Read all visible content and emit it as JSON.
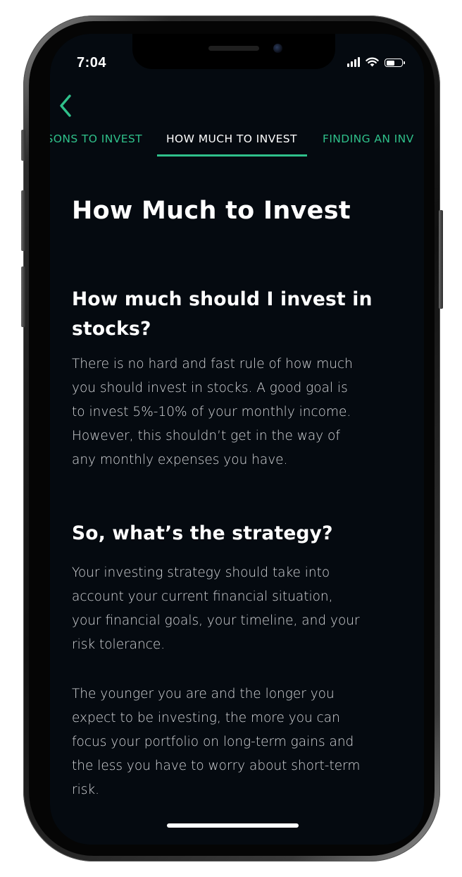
{
  "status_bar": {
    "time": "7:04",
    "battery_level": 0.55
  },
  "nav": {
    "back_icon": "chevron-left-icon",
    "accent_color": "#2fc08a"
  },
  "tabs": [
    {
      "label": "SONS TO INVEST",
      "active": false
    },
    {
      "label": "HOW MUCH TO INVEST",
      "active": true
    },
    {
      "label": "FINDING AN INV",
      "active": false
    }
  ],
  "article": {
    "title": "How Much to Invest",
    "sections": [
      {
        "heading_line1": "How much should I invest in",
        "heading_line2": "stocks?",
        "paragraphs": [
          {
            "lines": [
              "There is no hard and fast rule of how much",
              "you should invest in stocks. A good goal is",
              "to invest 5%-10% of your monthly income.",
              "However, this shouldn’t get in the way of",
              "any monthly expenses you have."
            ]
          }
        ]
      },
      {
        "heading_line1": "So, what’s the strategy?",
        "paragraphs": [
          {
            "lines": [
              "Your investing strategy should take into",
              "account your current financial situation,",
              "your financial goals, your timeline, and your",
              "risk tolerance."
            ]
          },
          {
            "lines": [
              "The younger you are and the longer you",
              "expect to be investing, the more you can",
              "focus your portfolio on long-term gains and",
              "the less you have to worry about short-term",
              "risk."
            ]
          }
        ]
      }
    ]
  }
}
